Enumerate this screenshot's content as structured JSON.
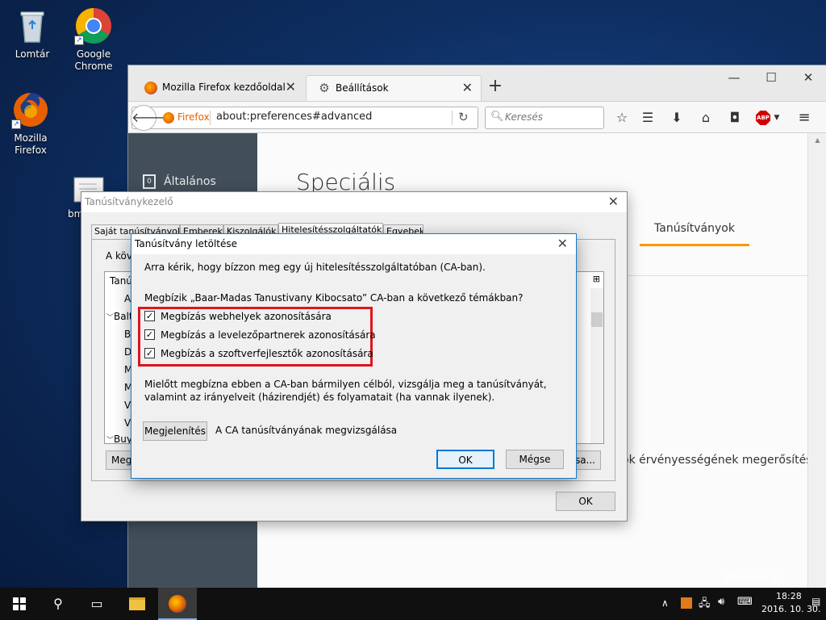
{
  "desktop": {
    "icons": [
      {
        "label": "Lomtár",
        "icon": "recycle-bin-icon"
      },
      {
        "label": "Google Chrome",
        "icon": "chrome-icon"
      },
      {
        "label": "Mozilla Firefox",
        "icon": "firefox-icon"
      },
      {
        "label": "bm",
        "icon": "certificate-file-icon"
      }
    ],
    "watermark": "Windows 10 Education"
  },
  "firefox": {
    "tabs": [
      {
        "label": "Mozilla Firefox kezdőoldal",
        "active": false
      },
      {
        "label": "Beállítások",
        "active": true
      }
    ],
    "identity_label": "Firefox",
    "url": "about:preferences#advanced",
    "search_placeholder": "Keresés",
    "sidebar_item": "Általános",
    "page_heading": "Speciális",
    "section_tab": "Tanúsítványok",
    "body_fragment": "ok érvényességének megerősítésh"
  },
  "cert_manager": {
    "title": "Tanúsítványkezelő",
    "tabs": [
      "Saját tanúsítványok",
      "Emberek",
      "Kiszolgálók",
      "Hitelesítésszolgáltatók",
      "Egyebek"
    ],
    "intro_fragment": "A köv",
    "tree_header": "Tanús",
    "tree_items": [
      "A",
      "Balt",
      "B",
      "D",
      "M",
      "M",
      "Ve",
      "Ve",
      "Buy"
    ],
    "left_button_fragment": "Meg",
    "right_button_fragment": "sa...",
    "ok_label": "OK"
  },
  "download_dialog": {
    "title": "Tanúsítvány letöltése",
    "intro": "Arra kérik, hogy bízzon meg egy új hitelesítésszolgáltatóban (CA-ban).",
    "question": "Megbízik „Baar-Madas Tanustivany Kibocsato” CA-ban a következő témákban?",
    "checkboxes": [
      {
        "label": "Megbízás webhelyek azonosítására",
        "checked": true
      },
      {
        "label": "Megbízás a levelezőpartnerek azonosítására",
        "checked": true
      },
      {
        "label": "Megbízás a szoftverfejlesztők azonosítására",
        "checked": true
      }
    ],
    "advice": "Mielőtt megbízna ebben a CA-ban bármilyen célból, vizsgálja meg a tanúsítványát, valamint az irányelveit (házirendjét) és folyamatait (ha vannak ilyenek).",
    "view_button": "Megjelenítés",
    "view_caption": "A CA tanúsítványának megvizsgálása",
    "ok_button": "OK",
    "cancel_button": "Mégse",
    "highlight_color": "#e0141e"
  },
  "taskbar": {
    "time": "18:28",
    "date": "2016. 10. 30."
  }
}
